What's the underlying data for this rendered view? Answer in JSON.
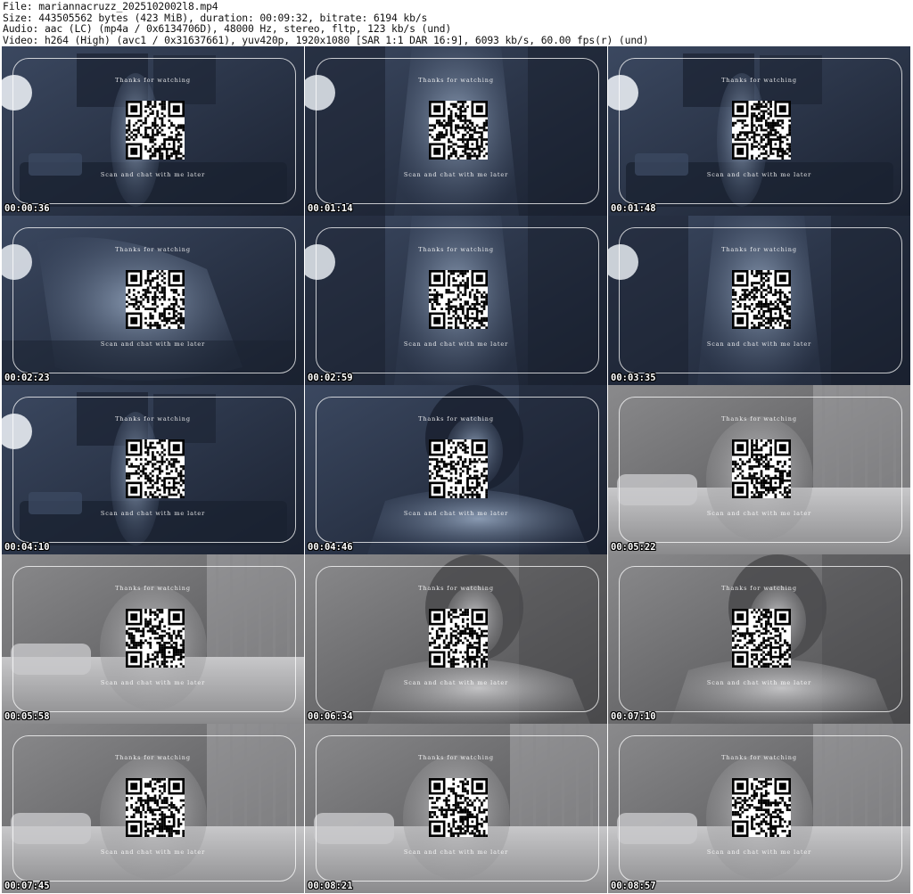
{
  "header": {
    "file": "File: mariannacruzz_2025102002l8.mp4",
    "size": "Size: 443505562 bytes (423 MiB), duration: 00:09:32, bitrate: 6194 kb/s",
    "audio": "Audio: aac (LC) (mp4a / 0x6134706D), 48000 Hz, stereo, fltp, 123 kb/s (und)",
    "video": "Video: h264 (High) (avc1 / 0x31637661), yuv420p, 1920x1080 [SAR 1:1 DAR 16:9], 6093 kb/s, 60.00 fps(r) (und)"
  },
  "overlay": {
    "thanks_text": "Thanks for watching",
    "scan_text": "Scan and chat with me later"
  },
  "thumbnails": [
    {
      "timestamp": "00:00:36",
      "tone": "blue",
      "scene": "room"
    },
    {
      "timestamp": "00:01:14",
      "tone": "blue",
      "scene": "dress"
    },
    {
      "timestamp": "00:01:48",
      "tone": "blue",
      "scene": "room"
    },
    {
      "timestamp": "00:02:23",
      "tone": "blue",
      "scene": "blur"
    },
    {
      "timestamp": "00:02:59",
      "tone": "blue",
      "scene": "dress"
    },
    {
      "timestamp": "00:03:35",
      "tone": "blue",
      "scene": "dress"
    },
    {
      "timestamp": "00:04:10",
      "tone": "blue",
      "scene": "room"
    },
    {
      "timestamp": "00:04:46",
      "tone": "blue",
      "scene": "face"
    },
    {
      "timestamp": "00:05:22",
      "tone": "grey",
      "scene": "bed"
    },
    {
      "timestamp": "00:05:58",
      "tone": "grey",
      "scene": "bed"
    },
    {
      "timestamp": "00:06:34",
      "tone": "grey",
      "scene": "face"
    },
    {
      "timestamp": "00:07:10",
      "tone": "grey",
      "scene": "face"
    },
    {
      "timestamp": "00:07:45",
      "tone": "grey",
      "scene": "bed"
    },
    {
      "timestamp": "00:08:21",
      "tone": "grey",
      "scene": "bed"
    },
    {
      "timestamp": "00:08:57",
      "tone": "grey",
      "scene": "bed"
    }
  ],
  "colors": {
    "blue_dark": "#1a2130",
    "blue_mid": "#3b4860",
    "blue_light": "#8fa0b8",
    "grey_dark": "#4a4a4c",
    "grey_mid": "#8a8a8c",
    "grey_light": "#c8c8ca"
  }
}
